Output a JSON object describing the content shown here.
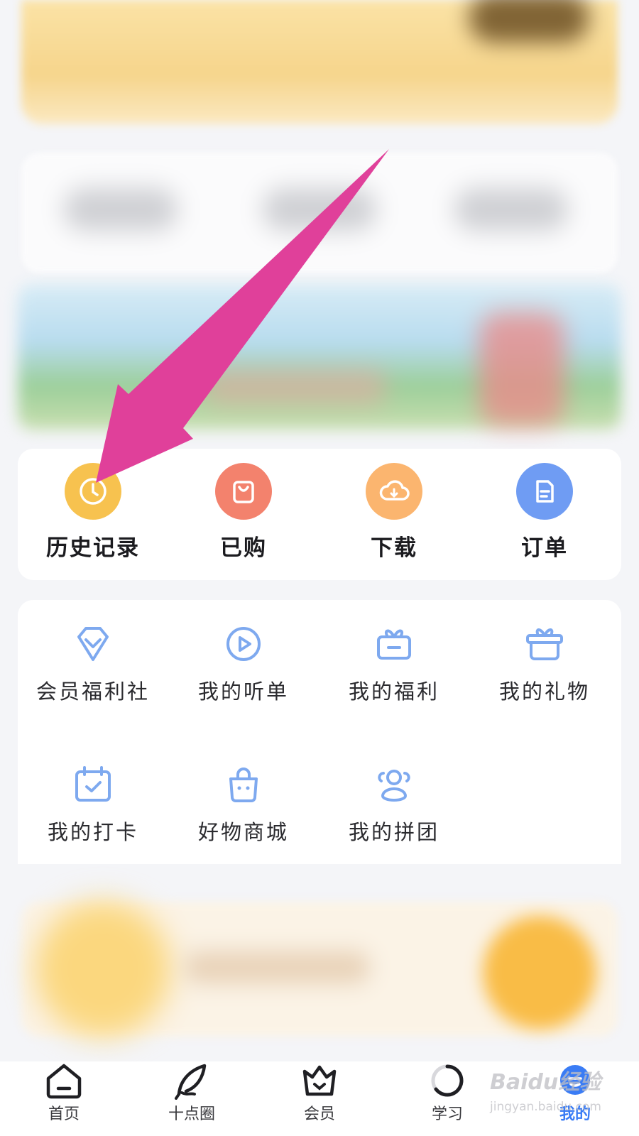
{
  "quick_actions": [
    {
      "label": "历史记录",
      "icon": "clock-icon",
      "color": "#f7c24f"
    },
    {
      "label": "已购",
      "icon": "shopping-bag-icon",
      "color": "#f3826d"
    },
    {
      "label": "下载",
      "icon": "cloud-download-icon",
      "color": "#fbb56f"
    },
    {
      "label": "订单",
      "icon": "document-icon",
      "color": "#6f9cf3"
    }
  ],
  "menu": [
    {
      "label": "会员福利社",
      "icon": "diamond-icon"
    },
    {
      "label": "我的听单",
      "icon": "play-circle-icon"
    },
    {
      "label": "我的福利",
      "icon": "gift-box-icon"
    },
    {
      "label": "我的礼物",
      "icon": "present-icon"
    },
    {
      "label": "我的打卡",
      "icon": "calendar-check-icon"
    },
    {
      "label": "好物商城",
      "icon": "shopping-bag-icon"
    },
    {
      "label": "我的拼团",
      "icon": "group-icon"
    }
  ],
  "tabs": [
    {
      "label": "首页",
      "icon": "home-icon"
    },
    {
      "label": "十点圈",
      "icon": "feather-icon"
    },
    {
      "label": "会员",
      "icon": "crown-icon"
    },
    {
      "label": "学习",
      "icon": "progress-ring-icon"
    },
    {
      "label": "我的",
      "icon": "profile-icon",
      "active": true
    }
  ],
  "watermark": {
    "brand": "Baidu经验",
    "domain": "jingyan.baidu.com"
  },
  "colors": {
    "accent": "#3a7cf5",
    "icon_blue": "#7ea9ef",
    "annotation_arrow": "#e0409a"
  }
}
